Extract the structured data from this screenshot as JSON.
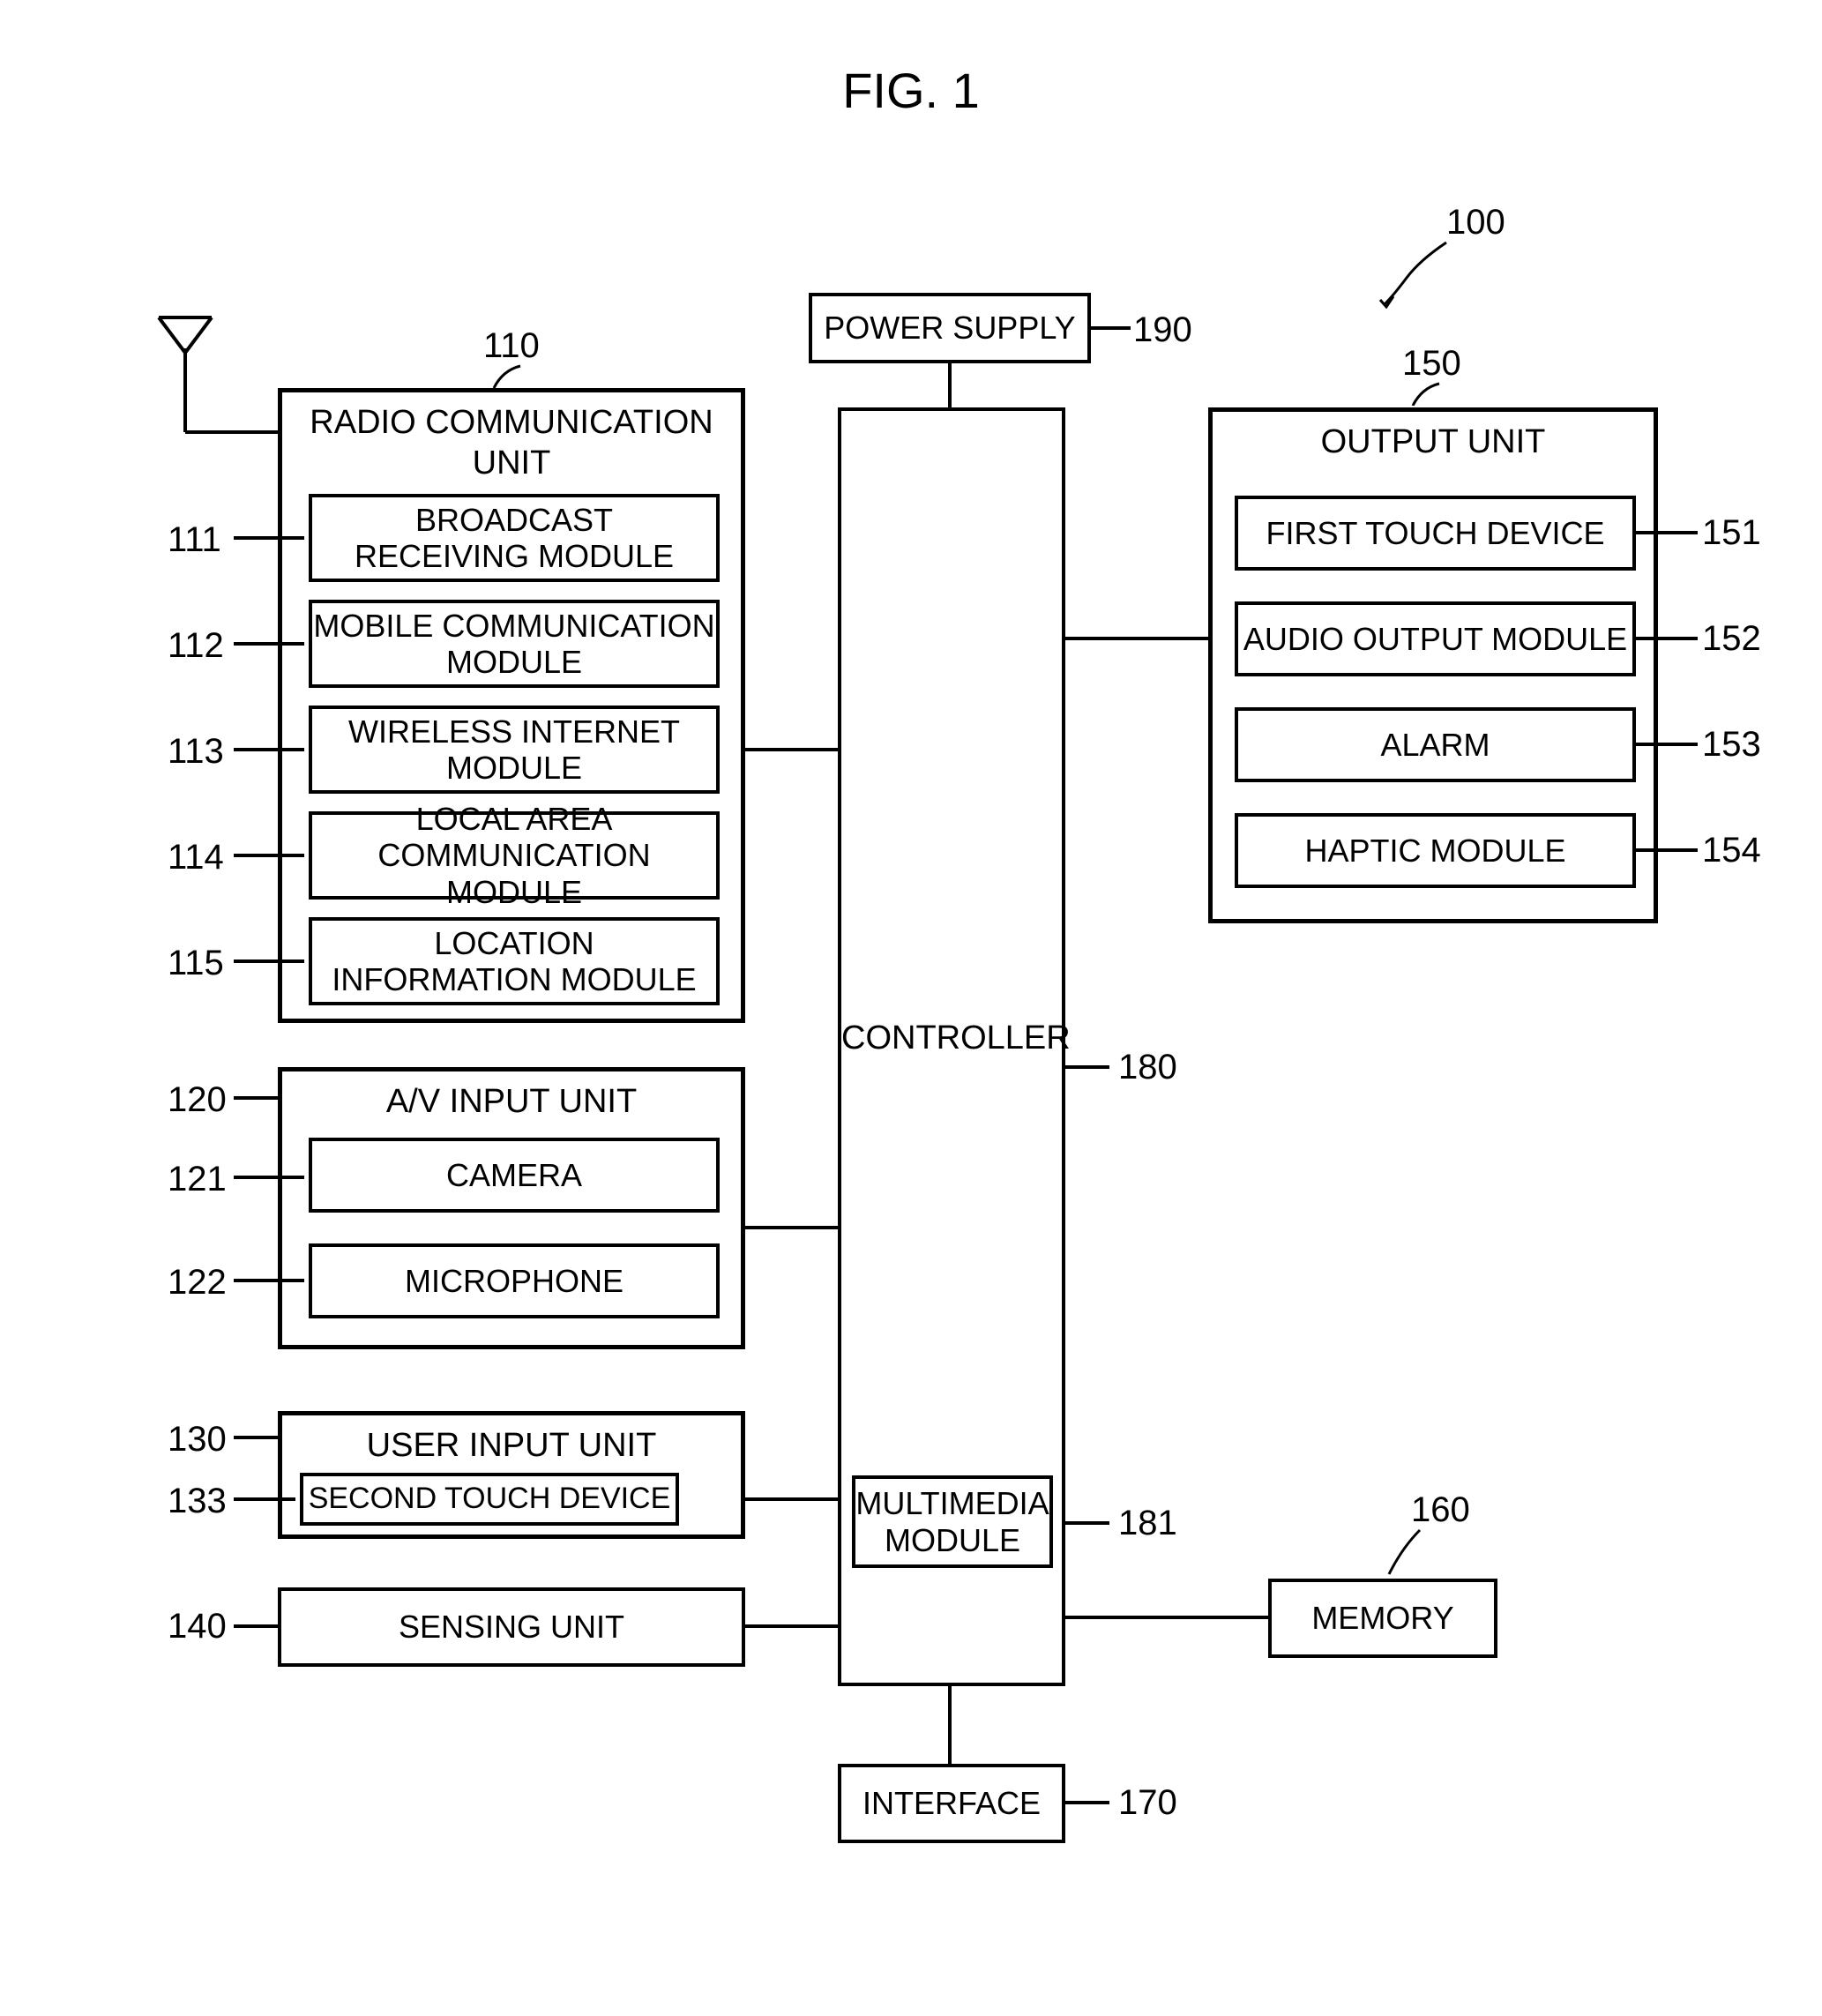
{
  "figure_title": "FIG. 1",
  "system_ref": "100",
  "power_supply": {
    "label": "POWER SUPPLY",
    "ref": "190"
  },
  "controller": {
    "label": "CONTROLLER",
    "ref": "180"
  },
  "multimedia": {
    "label": "MULTIMEDIA\nMODULE",
    "ref": "181"
  },
  "memory": {
    "label": "MEMORY",
    "ref": "160"
  },
  "interface": {
    "label": "INTERFACE",
    "ref": "170"
  },
  "radio_unit": {
    "title": "RADIO COMMUNICATION\nUNIT",
    "ref": "110",
    "items": [
      {
        "label": "BROADCAST\nRECEIVING MODULE",
        "ref": "111"
      },
      {
        "label": "MOBILE COMMUNICATION\nMODULE",
        "ref": "112"
      },
      {
        "label": "WIRELESS INTERNET\nMODULE",
        "ref": "113"
      },
      {
        "label": "LOCAL AREA\nCOMMUNICATION MODULE",
        "ref": "114"
      },
      {
        "label": "LOCATION\nINFORMATION MODULE",
        "ref": "115"
      }
    ]
  },
  "av_input": {
    "title": "A/V INPUT UNIT",
    "ref": "120",
    "items": [
      {
        "label": "CAMERA",
        "ref": "121"
      },
      {
        "label": "MICROPHONE",
        "ref": "122"
      }
    ]
  },
  "user_input": {
    "title": "USER INPUT UNIT",
    "ref": "130",
    "item": {
      "label": "SECOND TOUCH DEVICE",
      "ref": "133"
    }
  },
  "sensing": {
    "label": "SENSING UNIT",
    "ref": "140"
  },
  "output_unit": {
    "title": "OUTPUT UNIT",
    "ref": "150",
    "items": [
      {
        "label": "FIRST TOUCH DEVICE",
        "ref": "151"
      },
      {
        "label": "AUDIO OUTPUT MODULE",
        "ref": "152"
      },
      {
        "label": "ALARM",
        "ref": "153"
      },
      {
        "label": "HAPTIC MODULE",
        "ref": "154"
      }
    ]
  }
}
